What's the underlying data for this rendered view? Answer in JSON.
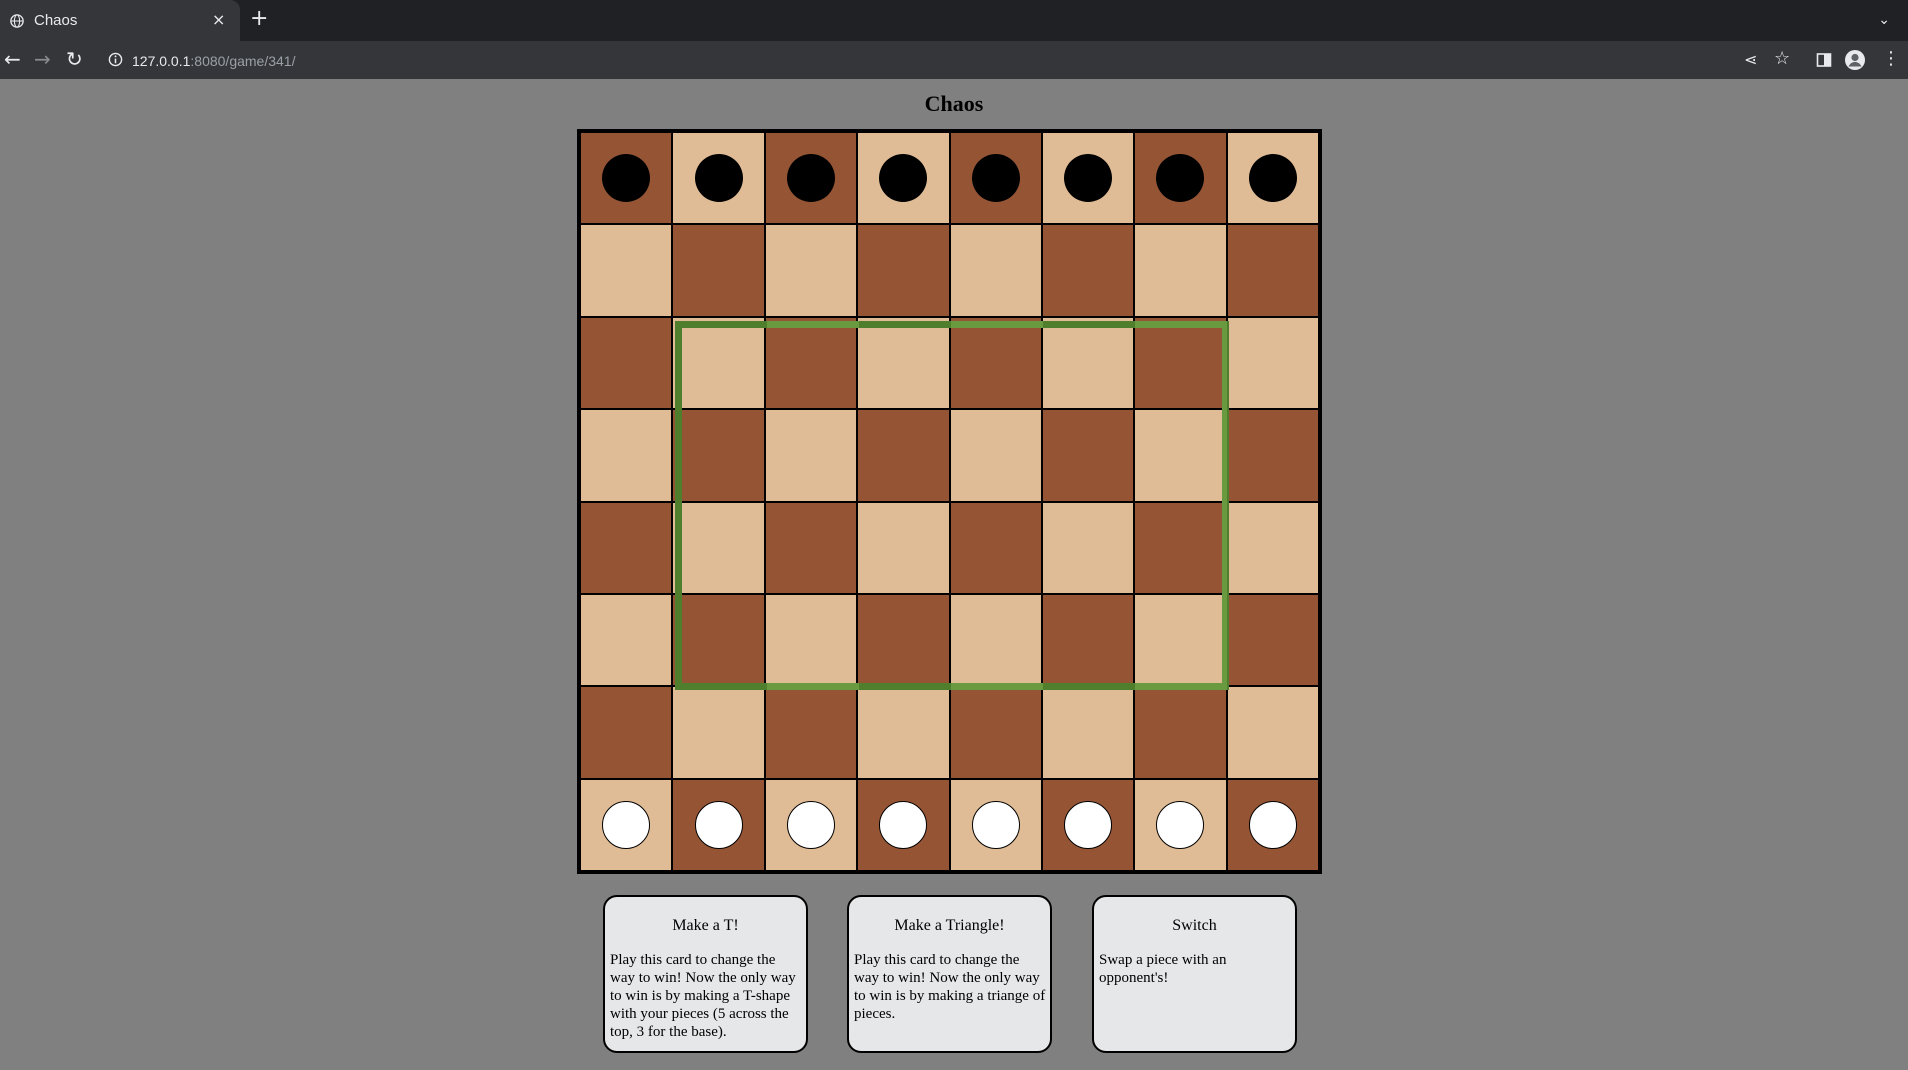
{
  "browser": {
    "tab_title": "Chaos",
    "tab_close": "×",
    "new_tab": "+",
    "tab_menu": "⌄",
    "back": "←",
    "forward": "→",
    "reload": "↻",
    "url_host": "127.0.0.1",
    "url_path": ":8080/game/341/",
    "share": "⋖",
    "star": "☆",
    "menu": "⋮"
  },
  "page": {
    "title": "Chaos"
  },
  "board": {
    "rows": 8,
    "cols": 8,
    "top_row_pieces": "black",
    "bottom_row_pieces": "white",
    "zone_color": "#5f8d3a",
    "light_color": "#e0bc96",
    "dark_color": "#955535"
  },
  "cards": [
    {
      "title": "Make a T!",
      "description": "Play this card to change the way to win! Now the only way to win is by making a T-shape with your pieces (5 across the top, 3 for the base)."
    },
    {
      "title": "Make a Triangle!",
      "description": "Play this card to change the way to win! Now the only way to win is by making a triange of pieces."
    },
    {
      "title": "Switch",
      "description": "Swap a piece with an opponent's!"
    }
  ]
}
